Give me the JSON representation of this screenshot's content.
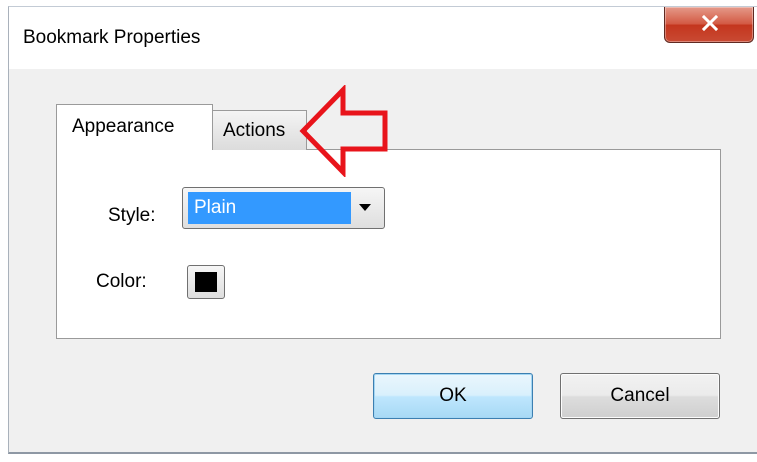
{
  "dialog": {
    "title": "Bookmark Properties",
    "close_icon": "close-icon"
  },
  "tabs": [
    {
      "label": "Appearance",
      "selected": true
    },
    {
      "label": "Actions",
      "selected": false
    }
  ],
  "appearance": {
    "style_label": "Style:",
    "style_value": "Plain",
    "color_label": "Color:",
    "color_value": "#000000"
  },
  "buttons": {
    "ok_label": "OK",
    "cancel_label": "Cancel"
  },
  "annotation": {
    "arrow_icon": "left-arrow-outline-icon",
    "arrow_color": "#e8141b"
  },
  "colors": {
    "selection": "#3399ff",
    "close_button": "#c94a33",
    "dialog_background": "#f0f0f0"
  }
}
